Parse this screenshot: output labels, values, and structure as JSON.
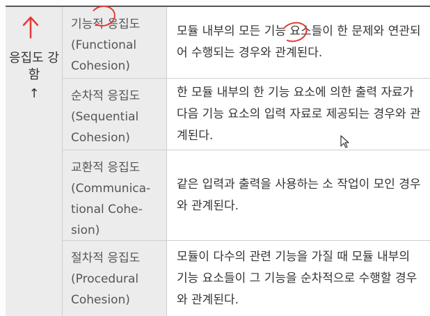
{
  "side": {
    "label": "응집도 강함",
    "arrow": "↑"
  },
  "rows": [
    {
      "name": "기능적 응집도 (Functional Cohesion)",
      "desc": "모듈 내부의 모든 기능 요소들이 한 문제와 연관되어 수행되는 경우와 관계된다."
    },
    {
      "name": "순차적 응집도 (Sequential Cohesion)",
      "desc": "한 모듈 내부의 한 기능 요소에 의한 출력 자료가 다음 기능 요소의 입력 자료로 제공되는 경우와 관계된다."
    },
    {
      "name": "교환적 응집도 (Communica-tional Cohe-sion)",
      "desc": "같은 입력과 출력을 사용하는 소 작업이 모인 경우와 관계된다."
    },
    {
      "name": "절차적 응집도 (Procedural Cohesion)",
      "desc": "모듈이 다수의 관련 기능을 가질 때 모듈 내부의 기능 요소들이 그 기능을 순차적으로 수행할 경우와 관계된다."
    }
  ],
  "colors": {
    "annotation": "#e53935",
    "header_bg": "#ececec"
  }
}
